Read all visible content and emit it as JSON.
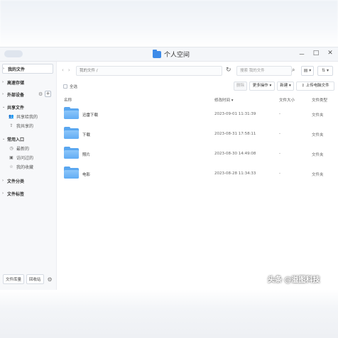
{
  "window": {
    "title": "个人空间",
    "controls": [
      "－",
      "□",
      "✕"
    ]
  },
  "sidebar": {
    "my_files": "我的文件",
    "high_speed_storage": "高速存储",
    "external_devices": "外部设备",
    "shared_files": {
      "label": "共享文件",
      "items": [
        "共享给我的",
        "我共享的"
      ]
    },
    "common_entry": {
      "label": "常用入口",
      "items": [
        "最新的",
        "访问过的",
        "我的收藏"
      ]
    },
    "file_category": "文件分类",
    "file_tags": "文件标签",
    "bottom": {
      "library_btn": "文件库量",
      "recycle_btn": "回收站"
    }
  },
  "toolbar": {
    "path": "我的文件 /",
    "search_placeholder": "搜索 我的文件",
    "view_label": "▤ ▾",
    "sort_label": "⇅ ▾"
  },
  "actions": {
    "select_all": "全选",
    "delete": "删除",
    "more_ops": "更多操作 ▾",
    "new": "新建 ▾",
    "upload": "⇪ 上传电脑文件"
  },
  "columns": {
    "name": "名称",
    "modified": "修改时间 ▾",
    "size": "文件大小",
    "type": "文件类型"
  },
  "files": [
    {
      "name": "迅雷下载",
      "date": "2023-09-01 11:31:39",
      "size": "-",
      "type": "文件夹"
    },
    {
      "name": "下载",
      "date": "2023-08-31 17:58:11",
      "size": "-",
      "type": "文件夹"
    },
    {
      "name": "照片",
      "date": "2023-08-30 14:49:08",
      "size": "-",
      "type": "文件夹"
    },
    {
      "name": "电影",
      "date": "2023-08-28 11:34:33",
      "size": "-",
      "type": "文件夹"
    }
  ],
  "watermark": "头条 @溢图科技"
}
